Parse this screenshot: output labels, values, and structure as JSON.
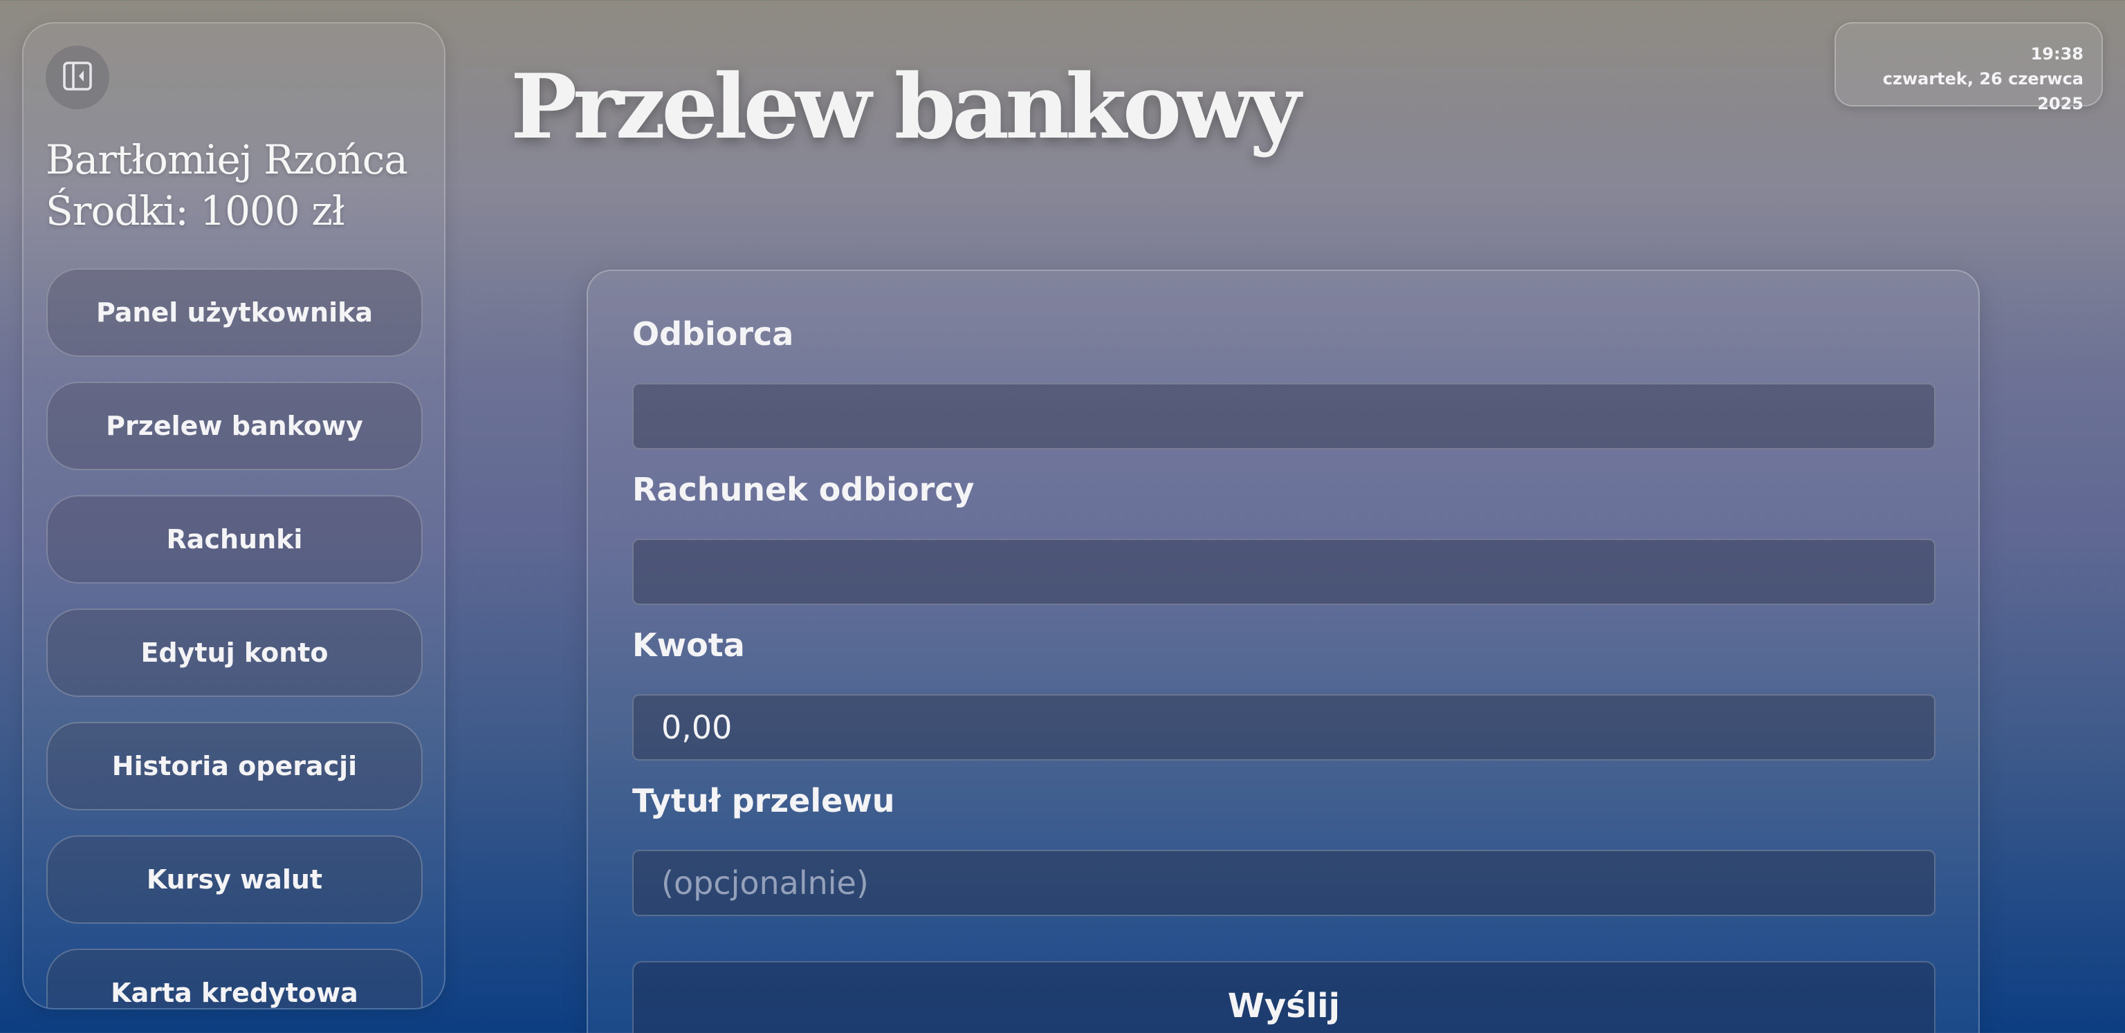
{
  "sidebar": {
    "collapse_icon": "sidebar-collapse-icon",
    "user_name": "Bartłomiej Rzońca",
    "balance": "Środki: 1000 zł",
    "items": [
      {
        "label": "Panel użytkownika"
      },
      {
        "label": "Przelew bankowy"
      },
      {
        "label": "Rachunki"
      },
      {
        "label": "Edytuj konto"
      },
      {
        "label": "Historia operacji"
      },
      {
        "label": "Kursy walut"
      },
      {
        "label": "Karta kredytowa"
      }
    ]
  },
  "header": {
    "title": "Przelew bankowy"
  },
  "clock": {
    "time": "19:38",
    "date": "czwartek, 26 czerwca 2025"
  },
  "form": {
    "recipient": {
      "label": "Odbiorca",
      "value": "",
      "placeholder": ""
    },
    "account": {
      "label": "Rachunek odbiorcy",
      "value": "",
      "placeholder": ""
    },
    "amount": {
      "label": "Kwota",
      "value": "0,00"
    },
    "title": {
      "label": "Tytuł przelewu",
      "value": "",
      "placeholder": "(opcjonalnie)"
    },
    "submit_label": "Wyślij"
  },
  "colors": {
    "background_top": "#8f8b82",
    "background_bottom": "#0d3e82",
    "text": "#f4f4f6"
  }
}
